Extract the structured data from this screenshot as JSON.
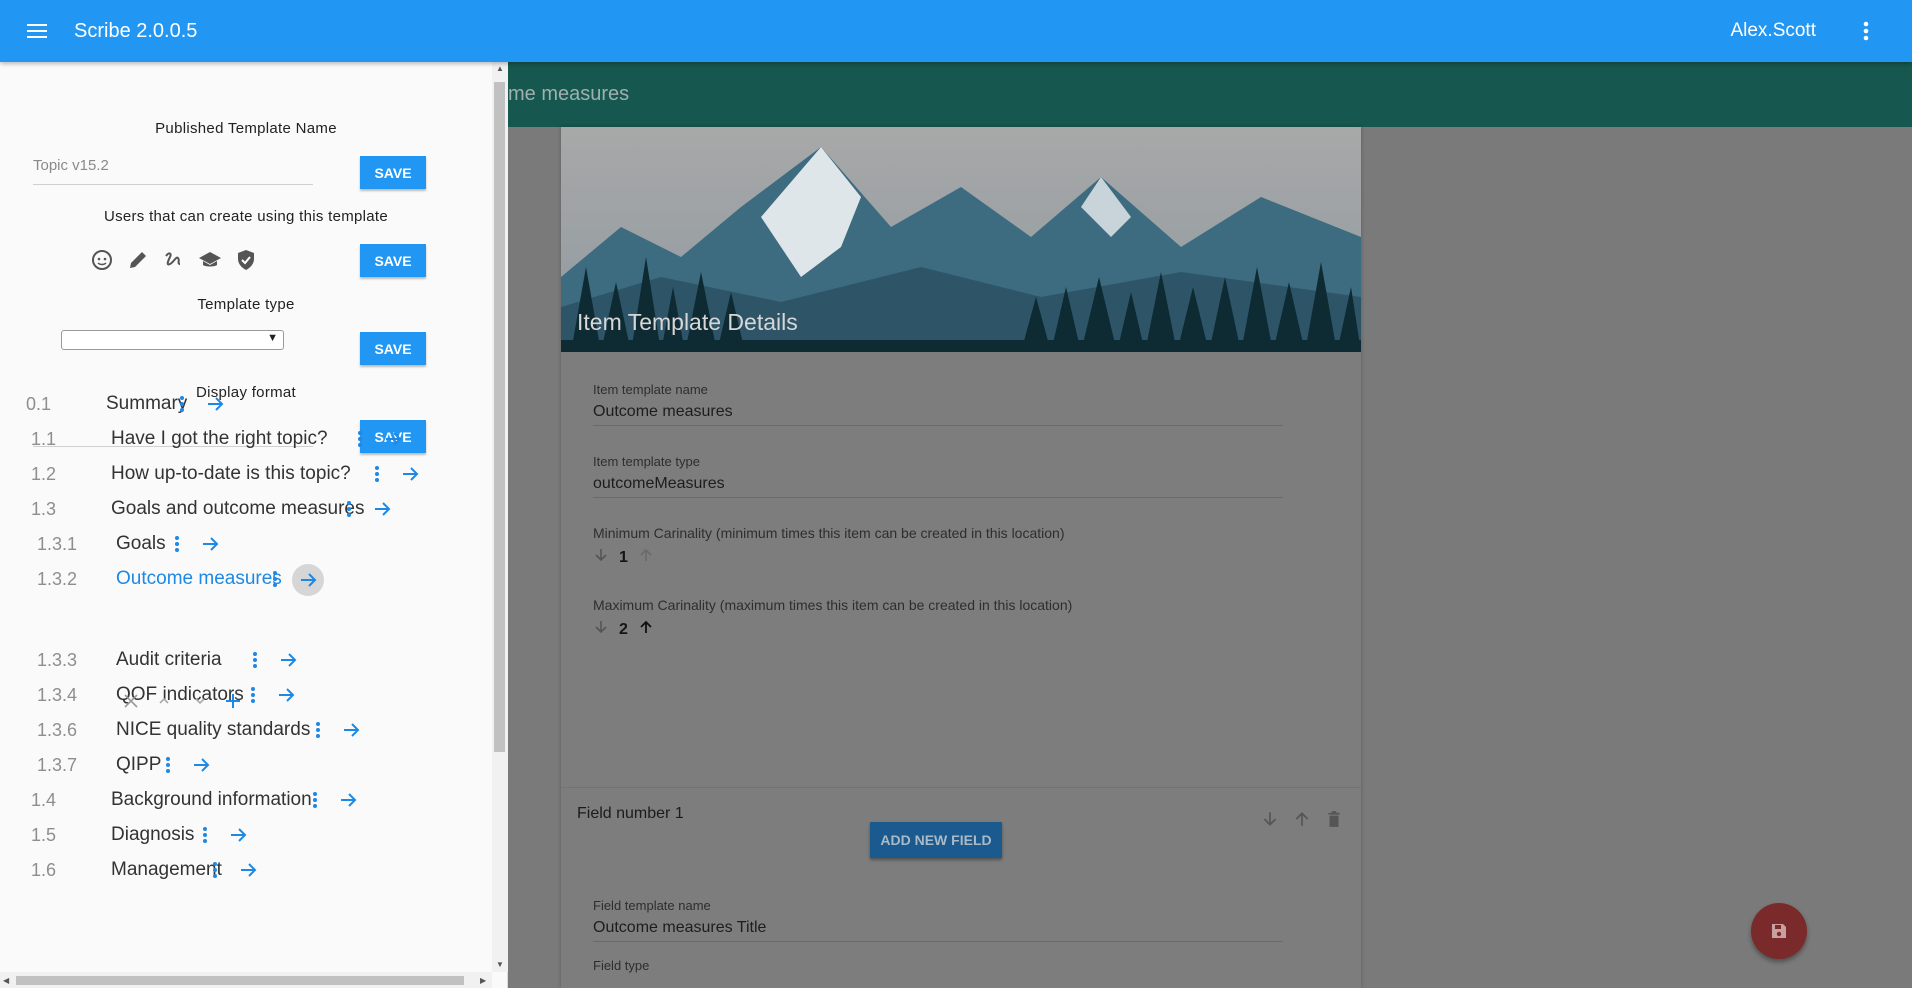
{
  "app": {
    "title": "Scribe 2.0.0.5",
    "user": "Alex.Scott"
  },
  "subheader": {
    "title": "me measures"
  },
  "hero": {
    "title": "Item Template Details"
  },
  "form": {
    "name_label": "Item template name",
    "name_value": "Outcome measures",
    "type_label": "Item template type",
    "type_value": "outcomeMeasures",
    "min_label": "Minimum Carinality (minimum times this item can be created in this location)",
    "min_value": "1",
    "max_label": "Maximum Carinality (maximum times this item can be created in this location)",
    "max_value": "2",
    "add_button": "ADD NEW FIELD",
    "field_number": "Field number 1",
    "field_name_label": "Field template name",
    "field_name_value": "Outcome measures Title",
    "field_type_label": "Field type"
  },
  "drawer": {
    "published_label": "Published Template Name",
    "published_value": "Topic v15.2",
    "users_label": "Users that can create using this template",
    "type_label": "Template type",
    "type_value": "",
    "display_label": "Display format",
    "display_value": "",
    "save_label": "SAVE",
    "role_icons": [
      "face-icon",
      "pencil-icon",
      "signature-icon",
      "school-icon",
      "shield-check-icon"
    ],
    "tree": [
      {
        "num": "0.1",
        "label": "Summary",
        "active": false
      },
      {
        "num": "1.1",
        "label": "Have I got the right topic?",
        "active": false
      },
      {
        "num": "1.2",
        "label": "How up-to-date is this topic?",
        "active": false
      },
      {
        "num": "1.3",
        "label": "Goals and outcome measures",
        "active": false
      },
      {
        "num": "1.3.1",
        "label": "Goals",
        "active": false
      },
      {
        "num": "1.3.2",
        "label": "Outcome measures",
        "active": true
      },
      {
        "num": "1.3.3",
        "label": "Audit criteria",
        "active": false
      },
      {
        "num": "1.3.4",
        "label": "QOF indicators",
        "active": false
      },
      {
        "num": "1.3.6",
        "label": "NICE quality standards",
        "active": false
      },
      {
        "num": "1.3.7",
        "label": "QIPP",
        "active": false
      },
      {
        "num": "1.4",
        "label": "Background information",
        "active": false
      },
      {
        "num": "1.5",
        "label": "Diagnosis",
        "active": false
      },
      {
        "num": "1.6",
        "label": "Management",
        "active": false
      }
    ]
  },
  "colors": {
    "primary": "#2196f3",
    "teal": "#16584f",
    "fab": "#7a2a2a"
  }
}
